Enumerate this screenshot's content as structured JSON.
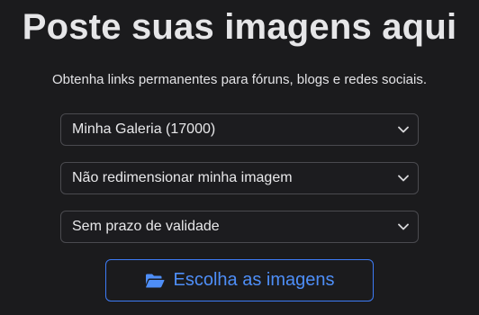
{
  "header": {
    "title": "Poste suas imagens aqui",
    "subtitle": "Obtenha links permanentes para fóruns, blogs e redes sociais."
  },
  "form": {
    "gallery_select": {
      "selected": "Minha Galeria (17000)"
    },
    "resize_select": {
      "selected": "Não redimensionar minha imagem"
    },
    "expiry_select": {
      "selected": "Sem prazo de validade"
    },
    "choose_button": {
      "label": "Escolha as imagens",
      "icon": "folder-open-icon"
    }
  },
  "colors": {
    "background": "#1b1b1d",
    "accent": "#4e8ef7",
    "border": "#4a4a4f"
  }
}
